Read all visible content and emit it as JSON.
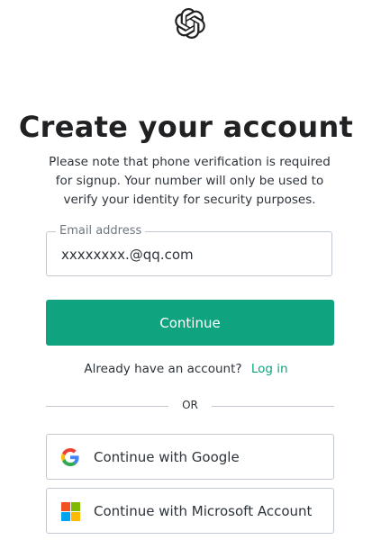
{
  "brand": {
    "logo_icon": "openai-logo-icon"
  },
  "header": {
    "title": "Create your account",
    "subtitle": "Please note that phone verification is required for signup. Your number will only be used to verify your identity for security purposes."
  },
  "form": {
    "email_label": "Email address",
    "email_value": "xxxxxxxx.@qq.com",
    "continue_label": "Continue"
  },
  "login": {
    "prompt": "Already have an account?",
    "link_label": "Log in"
  },
  "divider": {
    "text": "OR"
  },
  "social": {
    "google_label": "Continue with Google",
    "google_icon": "google-icon",
    "microsoft_label": "Continue with Microsoft Account",
    "microsoft_icon": "microsoft-icon"
  },
  "colors": {
    "accent": "#10a37f",
    "border": "#c2c8d0",
    "text": "#2d333a"
  }
}
